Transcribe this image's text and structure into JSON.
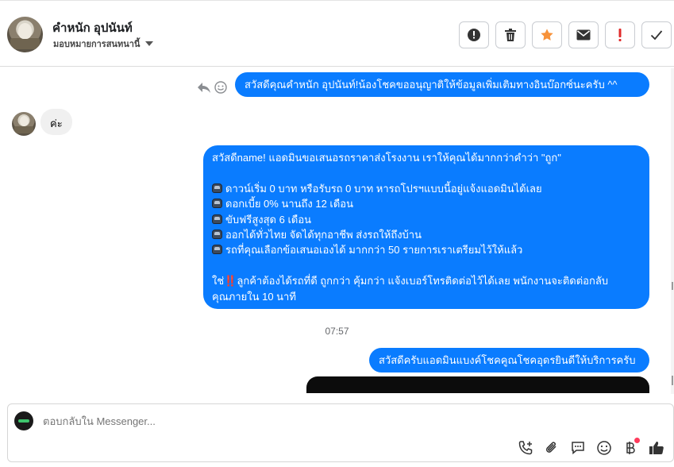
{
  "header": {
    "contact_name": "คำหนัก อุปนันท์",
    "assign_label": "มอบหมายการสนทนานี้",
    "actions": [
      {
        "name": "report-button",
        "icon": "alert-circle-icon"
      },
      {
        "name": "delete-button",
        "icon": "trash-icon"
      },
      {
        "name": "star-button",
        "icon": "star-icon",
        "color": "#f7923a"
      },
      {
        "name": "mark-unread-button",
        "icon": "envelope-icon"
      },
      {
        "name": "mark-important-button",
        "icon": "exclamation-icon",
        "color": "#e02b2b"
      },
      {
        "name": "mark-done-button",
        "icon": "checkmark-icon"
      }
    ]
  },
  "thread": {
    "msg1": "สวัสดีคุณคำหนัก อุปนันท์!น้องโชคขออนุญาติให้ข้อมูลเพิ่มเติมทางอินบ๊อกซ์นะครับ ^^",
    "msg2": "ค่ะ",
    "msg3": {
      "intro": "สวัสดีname! แอดมินขอเสนอรถราคาส่งโรงงาน เราให้คุณได้มากกว่าคำว่า \"ถูก\"",
      "bullets": [
        "ดาวน์เริ่ม 0 บาท หรือรับรถ 0 บาท หารถโปรฯแบบนี้อยู่แจ้งแอดมินได้เลย",
        "ดอกเบี้ย 0% นานถึง 12 เดือน",
        "ขับฟรีสูงสุด 6 เดือน",
        "ออกได้ทั่วไทย จัดได้ทุกอาชีพ ส่งรถให้ถึงบ้าน",
        "รถที่คุณเลือกข้อเสนอเองได้ มากกว่า 50 รายการเราเตรียมไว้ให้แล้ว"
      ],
      "closing_prefix": "ใช่",
      "closing_mark": "‼️",
      "closing_line1": "ลูกค้าต้องได้รถที่ดี ถูกกว่า คุ้มกว่า แจ้งเบอร์โทรติดต่อไว้ได้เลย พนักงานจะติดต่อกลับ",
      "closing_line2": "คุณภายใน 10 นาที"
    },
    "timestamp": "07:57",
    "msg4": "สวัสดีครับแอดมินแบงค์โชคคูณโชคอุดรยินดีให้บริการครับ"
  },
  "composer": {
    "placeholder": "ตอบกลับใน Messenger...",
    "tools": [
      "phone-add-icon",
      "paperclip-icon",
      "saved-replies-icon",
      "emoji-icon",
      "baht-icon",
      "thumbs-up-icon"
    ]
  },
  "colors": {
    "outgoing_bubble": "#0a7cff",
    "incoming_bubble": "#f0f0f0"
  }
}
